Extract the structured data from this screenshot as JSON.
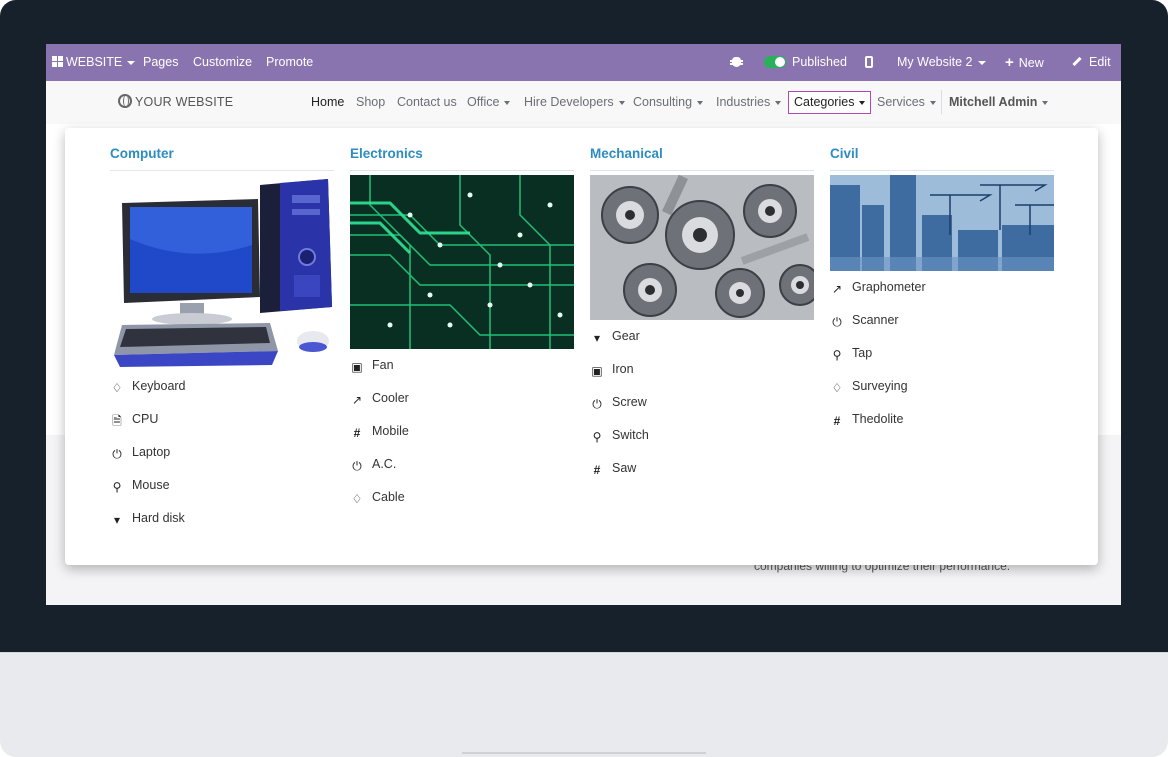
{
  "topbar": {
    "website_label": "WEBSITE",
    "pages": "Pages",
    "customize": "Customize",
    "promote": "Promote",
    "published": "Published",
    "my_website": "My Website 2",
    "new": "New",
    "edit": "Edit",
    "color": "#8a74b0"
  },
  "navbar": {
    "logo": "YOUR WEBSITE",
    "items": {
      "home": "Home",
      "shop": "Shop",
      "contact": "Contact us",
      "office": "Office",
      "hire": "Hire Developers",
      "consulting": "Consulting",
      "industries": "Industries",
      "categories": "Categories",
      "services": "Services",
      "admin": "Mitchell Admin"
    }
  },
  "background": {
    "text": "companies willing to optimize their performance."
  },
  "mega_menu": {
    "columns": [
      {
        "title": "Computer",
        "image": "computer-image",
        "items": [
          {
            "label": "Keyboard",
            "icon": "diamond-icon"
          },
          {
            "label": "CPU",
            "icon": "pdf-file-icon"
          },
          {
            "label": "Laptop",
            "icon": "power-icon"
          },
          {
            "label": "Mouse",
            "icon": "search-icon"
          },
          {
            "label": "Hard disk",
            "icon": "caret-down-icon"
          }
        ]
      },
      {
        "title": "Electronics",
        "image": "circuit-board-image",
        "items": [
          {
            "label": "Fan",
            "icon": "image-icon"
          },
          {
            "label": "Cooler",
            "icon": "share-icon"
          },
          {
            "label": "Mobile",
            "icon": "hashtag-icon"
          },
          {
            "label": "A.C.",
            "icon": "power-icon"
          },
          {
            "label": "Cable",
            "icon": "diamond-icon"
          }
        ]
      },
      {
        "title": "Mechanical",
        "image": "gears-image",
        "items": [
          {
            "label": "Gear",
            "icon": "caret-down-icon"
          },
          {
            "label": "Iron",
            "icon": "image-icon"
          },
          {
            "label": "Screw",
            "icon": "power-icon"
          },
          {
            "label": "Switch",
            "icon": "search-icon"
          },
          {
            "label": "Saw",
            "icon": "hashtag-icon"
          }
        ]
      },
      {
        "title": "Civil",
        "image": "construction-image",
        "items": [
          {
            "label": "Graphometer",
            "icon": "share-icon"
          },
          {
            "label": "Scanner",
            "icon": "power-icon"
          },
          {
            "label": "Tap",
            "icon": "search-icon"
          },
          {
            "label": "Surveying",
            "icon": "diamond-icon"
          },
          {
            "label": "Thedolite",
            "icon": "hashtag-icon"
          }
        ]
      }
    ]
  }
}
